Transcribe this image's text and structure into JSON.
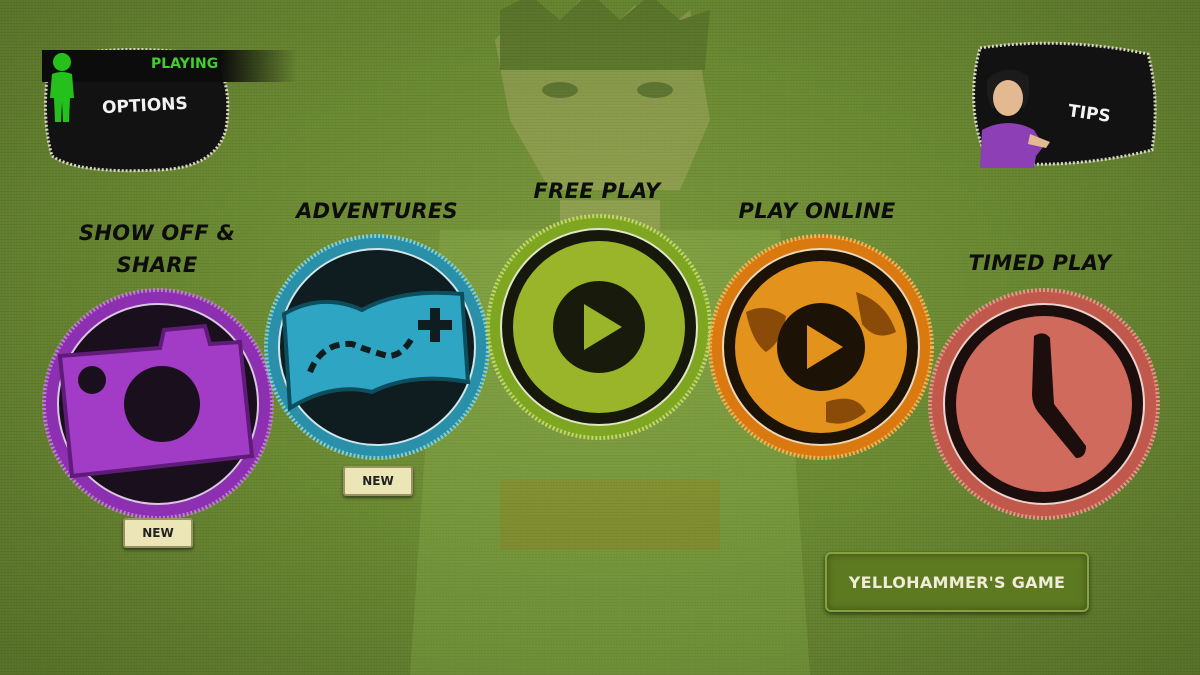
{
  "header": {
    "status_label": "PLAYING",
    "options_label": "OPTIONS",
    "tips_label": "TIPS"
  },
  "modes": [
    {
      "label_line1": "SHOW OFF &",
      "label_line2": "SHARE",
      "icon": "camera-icon",
      "color": "#8c2fb0",
      "new_label": "NEW"
    },
    {
      "label": "ADVENTURES",
      "icon": "map-icon",
      "color": "#2a8fa8",
      "new_label": "NEW"
    },
    {
      "label": "FREE PLAY",
      "icon": "play-icon",
      "color": "#7fa620"
    },
    {
      "label": "PLAY ONLINE",
      "icon": "globe-play-icon",
      "color": "#d9790f"
    },
    {
      "label": "TIMED PLAY",
      "icon": "clock-icon",
      "color": "#c0584c"
    }
  ],
  "footer": {
    "game_button_label": "YELLOHAMMER'S GAME"
  },
  "colors": {
    "background": "#6b8a33",
    "playing_text": "#3fd12a",
    "patch_black": "#151515"
  }
}
